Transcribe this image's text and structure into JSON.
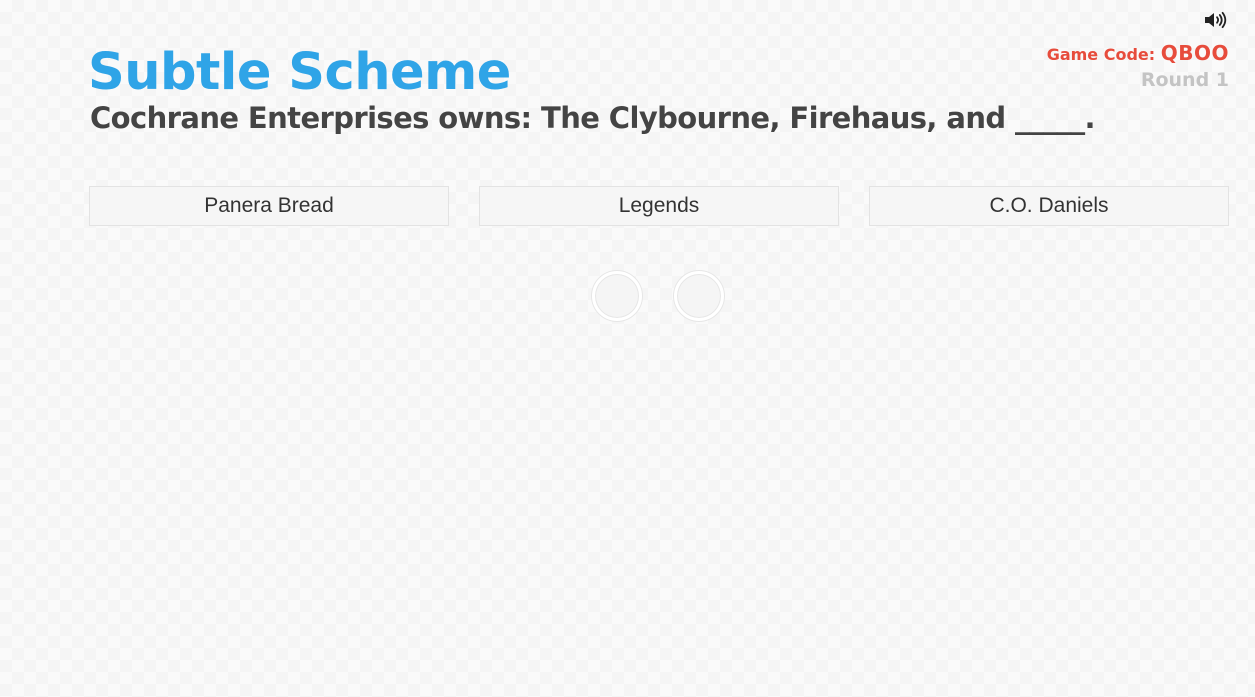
{
  "icons": {
    "sound": "speaker-volume-icon"
  },
  "colors": {
    "title": "#2fa4e7",
    "game_code": "#e74c3c",
    "round": "#c4c4c4",
    "question": "#444444",
    "choice_background": "#f6f6f6",
    "choice_border": "#e3e3e3"
  },
  "header": {
    "title": "Subtle Scheme",
    "game_code_label": "Game Code:",
    "game_code_value": "QBOO",
    "round_label": "Round 1"
  },
  "question": {
    "text": "Cochrane Enterprises owns: The Clybourne, Firehaus, and _____."
  },
  "choices": [
    {
      "label": "Panera Bread"
    },
    {
      "label": "Legends"
    },
    {
      "label": "C.O. Daniels"
    }
  ],
  "players": [
    {
      "avatar": "empty"
    },
    {
      "avatar": "empty"
    }
  ]
}
